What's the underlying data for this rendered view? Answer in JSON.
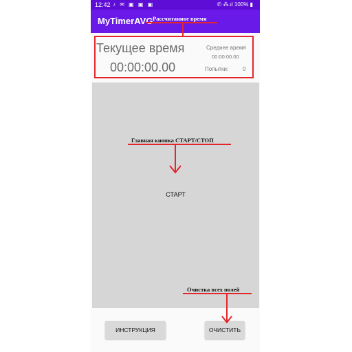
{
  "status_bar": {
    "time": "12:42",
    "left_icons": "♪ ✉ ▣ ▣ ▣",
    "right_status": "✆ ⁂.ıl 100% ▮"
  },
  "app_bar": {
    "title": "MyTimerAVG"
  },
  "info": {
    "current_label": "Текущее время",
    "current_time": "00:00:00.00",
    "average_label": "Среднее время",
    "average_time": "00:00:00.00",
    "attempts_label": "Попытки:",
    "attempts_count": "0"
  },
  "main_button": {
    "label": "СТАРТ"
  },
  "bottom_buttons": {
    "instruction": "ИНСТРУКЦИЯ",
    "clear": "ОЧИСТИТЬ"
  },
  "annotations": {
    "calculated_time": "Рассчитанное время",
    "main_button": "Главная кнопка СТАРТ/СТОП",
    "clear_fields": "Очистка всех полей"
  },
  "colors": {
    "status_bar": "#5e0dd6",
    "app_bar": "#6a1ae8",
    "annotation_red": "#e3262b",
    "main_button": "#d6d6d6"
  }
}
